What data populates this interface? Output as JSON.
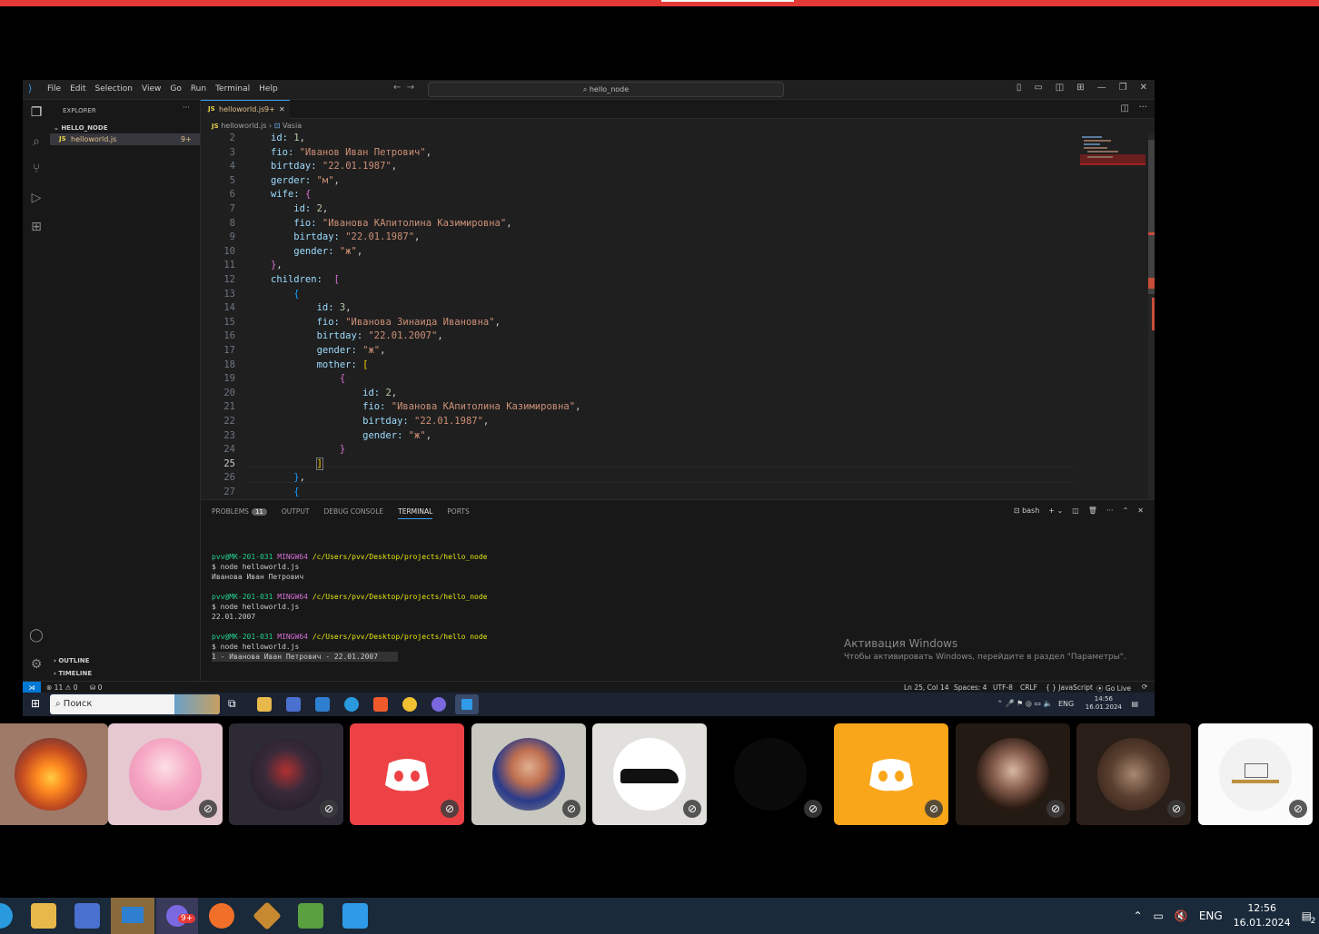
{
  "window": {
    "menu": [
      "File",
      "Edit",
      "Selection",
      "View",
      "Go",
      "Run",
      "Terminal",
      "Help"
    ],
    "search": "hello_node"
  },
  "sidebar": {
    "title": "EXPLORER",
    "folder": "HELLO_NODE",
    "file": "helloworld.js",
    "file_badge": "9+",
    "outline": "OUTLINE",
    "timeline": "TIMELINE"
  },
  "editor": {
    "tab_label": "helloworld.js",
    "tab_badge": "9+",
    "breadcrumb_file": "helloworld.js",
    "breadcrumb_symbol": "Vasia",
    "line_numbers": [
      "2",
      "3",
      "4",
      "5",
      "6",
      "7",
      "8",
      "9",
      "10",
      "11",
      "12",
      "13",
      "14",
      "15",
      "16",
      "17",
      "18",
      "19",
      "20",
      "21",
      "22",
      "23",
      "24",
      "25",
      "26",
      "27"
    ]
  },
  "panel": {
    "tabs": [
      "PROBLEMS",
      "OUTPUT",
      "DEBUG CONSOLE",
      "TERMINAL",
      "PORTS"
    ],
    "problems_count": "11",
    "shell": "bash",
    "prompt_user": "pvv@MK-201-031",
    "prompt_env": "MINGW64",
    "prompt_path": "/c/Users/pvv/Desktop/projects/hello_node",
    "prompt_path_alt": "/c/Users/pvv/Desktop/projects/hello node",
    "cmd": "$ node helloworld.js",
    "out1": "Иванова Иван Петрович",
    "out2": "22.01.2007",
    "out3": "1 - Иванова Иван Петрович - 22.01.2007",
    "prompt_end": "$"
  },
  "activation": {
    "title": "Активация Windows",
    "text": "Чтобы активировать Windows, перейдите в раздел \"Параметры\"."
  },
  "statusbar": {
    "errors": "⊗ 11 ⚠ 0",
    "ports": "⛁ 0",
    "position": "Ln 25, Col 14",
    "spaces": "Spaces: 4",
    "encoding": "UTF-8",
    "eol": "CRLF",
    "language": "{ } JavaScript",
    "golive": "⦿ Go Live"
  },
  "inner_taskbar": {
    "search": "Поиск",
    "lang": "ENG",
    "time": "14:56",
    "date": "16.01.2024"
  },
  "outer_taskbar": {
    "lang": "ENG",
    "time": "12:56",
    "date": "16.01.2024",
    "notif": "2",
    "discord_badge": "9+"
  },
  "colors": {
    "accent": "#0078d4",
    "discord_red": "#ed4245",
    "discord_orange": "#faa61a",
    "top_bar": "#e53935"
  }
}
